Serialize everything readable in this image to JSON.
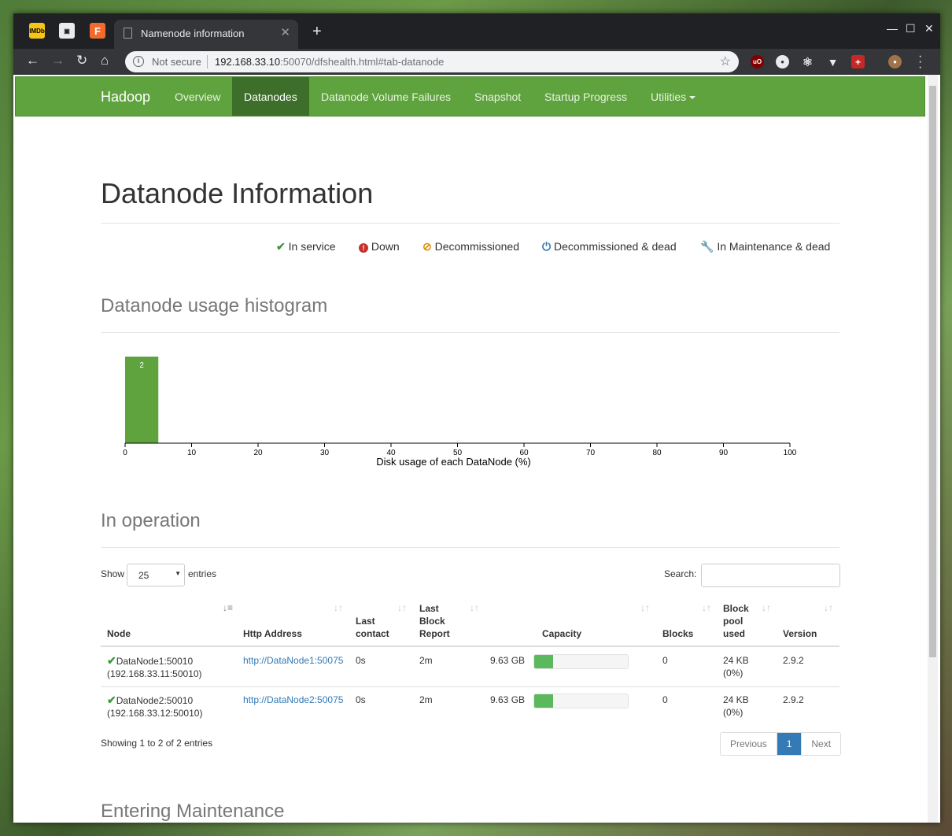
{
  "browser": {
    "tab_title": "Namenode information",
    "security": "Not secure",
    "url_host": "192.168.33.10",
    "url_rest": ":50070/dfshealth.html#tab-datanode"
  },
  "nav": {
    "brand": "Hadoop",
    "items": [
      "Overview",
      "Datanodes",
      "Datanode Volume Failures",
      "Snapshot",
      "Startup Progress",
      "Utilities"
    ]
  },
  "page_title": "Datanode Information",
  "legend": [
    {
      "label": "In service",
      "icon": "check-icon",
      "color": "#3c9a3c"
    },
    {
      "label": "Down",
      "icon": "exclamation-icon",
      "color": "#c9302c"
    },
    {
      "label": "Decommissioned",
      "icon": "ban-icon",
      "color": "#e08e0b"
    },
    {
      "label": "Decommissioned & dead",
      "icon": "power-icon",
      "color": "#337ab7"
    },
    {
      "label": "In Maintenance & dead",
      "icon": "wrench-icon",
      "color": "#f0ad4e"
    }
  ],
  "histogram_heading": "Datanode usage histogram",
  "chart_data": {
    "type": "bar",
    "bins": [
      {
        "x0": 0,
        "x1": 5,
        "count": 2
      }
    ],
    "xlabel": "Disk usage of each DataNode (%)",
    "xlim": [
      0,
      100
    ],
    "ticks": [
      0,
      10,
      20,
      30,
      40,
      50,
      60,
      70,
      80,
      90,
      100
    ],
    "color": "#5fa33e"
  },
  "in_operation": {
    "heading": "In operation",
    "show_label": "Show",
    "page_size": "25",
    "entries_label": "entries",
    "search_label": "Search:",
    "columns": [
      "Node",
      "Http Address",
      "Last contact",
      "Last Block Report",
      "Capacity",
      "Blocks",
      "Block pool used",
      "Version"
    ],
    "rows": [
      {
        "node": "DataNode1:50010",
        "node_ip": "(192.168.33.11:50010)",
        "http": "http://DataNode1:50075",
        "last_contact": "0s",
        "last_block": "2m",
        "capacity": "9.63 GB",
        "usage_fraction": 0.2,
        "blocks": "0",
        "pool_used": "24 KB",
        "pool_pct": "(0%)",
        "version": "2.9.2"
      },
      {
        "node": "DataNode2:50010",
        "node_ip": "(192.168.33.12:50010)",
        "http": "http://DataNode2:50075",
        "last_contact": "0s",
        "last_block": "2m",
        "capacity": "9.63 GB",
        "usage_fraction": 0.2,
        "blocks": "0",
        "pool_used": "24 KB",
        "pool_pct": "(0%)",
        "version": "2.9.2"
      }
    ],
    "info": "Showing 1 to 2 of 2 entries",
    "pager": {
      "prev": "Previous",
      "current": "1",
      "next": "Next"
    }
  },
  "entering_maintenance_heading": "Entering Maintenance"
}
